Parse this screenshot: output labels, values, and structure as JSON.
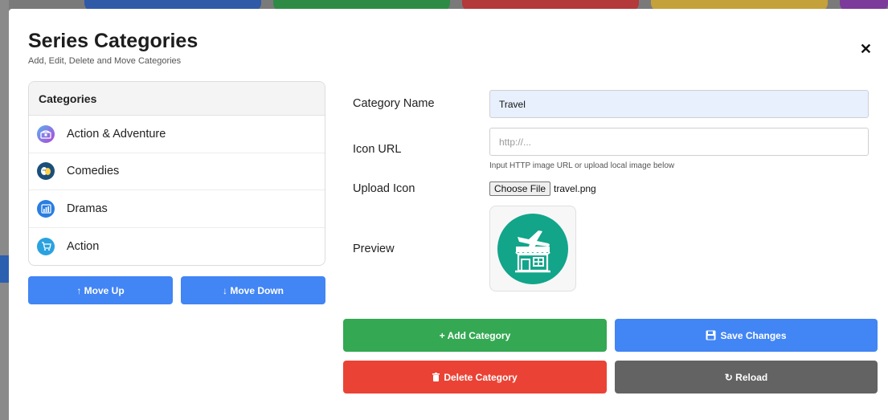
{
  "background_tabs": [
    {
      "color": "#2f5aa8"
    },
    {
      "color": "#2e8b46"
    },
    {
      "color": "#b3393a"
    },
    {
      "color": "#c4a13a"
    },
    {
      "color": "#7c3a9a"
    }
  ],
  "modal": {
    "title": "Series Categories",
    "subtitle": "Add, Edit, Delete and Move Categories",
    "close_icon": "close-icon",
    "close_glyph": "✕"
  },
  "categories_panel": {
    "header": "Categories",
    "items": [
      {
        "label": "Action & Adventure",
        "icon": "treasure-chest-icon",
        "icon_color": "#a44bd6"
      },
      {
        "label": "Comedies",
        "icon": "theater-masks-icon",
        "icon_color": "#1b4f7a"
      },
      {
        "label": "Dramas",
        "icon": "chart-icon",
        "icon_color": "#2a7de1"
      },
      {
        "label": "Action",
        "icon": "shopping-cart-icon",
        "icon_color": "#2aa2e0"
      }
    ]
  },
  "move_buttons": {
    "up": "↑ Move Up",
    "down": "↓ Move Down"
  },
  "form": {
    "category_name_label": "Category Name",
    "category_name_value": "Travel",
    "icon_url_label": "Icon URL",
    "icon_url_placeholder": "http://...",
    "icon_url_hint": "Input HTTP image URL or upload local image below",
    "upload_label": "Upload Icon",
    "choose_file_label": "Choose File",
    "file_name": "travel.png",
    "preview_label": "Preview",
    "preview_icon": "travel-shop-icon",
    "preview_color": "#12a58a"
  },
  "actions": {
    "add": "+ Add Category",
    "save": "Save Changes",
    "delete": "Delete Category",
    "reload": "↻ Reload"
  },
  "colors": {
    "primary": "#4285f4",
    "success": "#34a853",
    "danger": "#ea4335",
    "neutral": "#636363"
  }
}
